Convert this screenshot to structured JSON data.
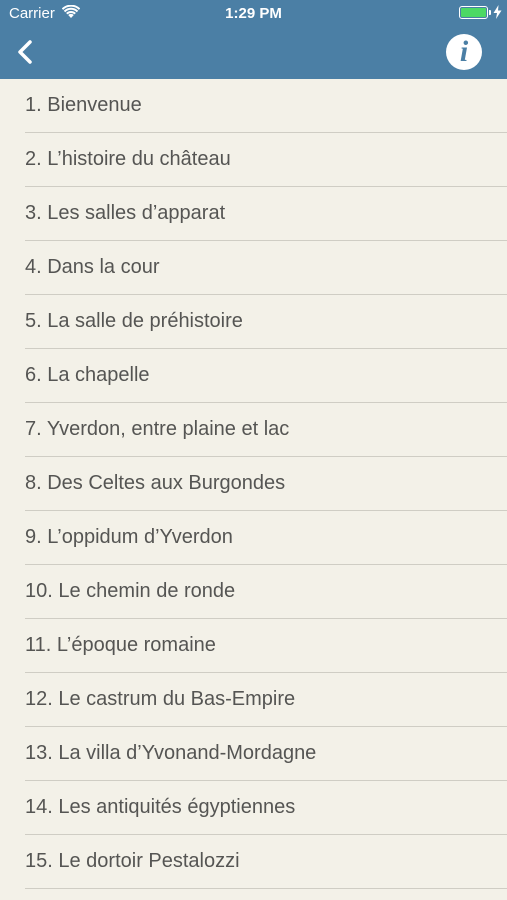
{
  "status_bar": {
    "carrier": "Carrier",
    "time": "1:29 PM",
    "battery_level": 1.0,
    "battery_color": "#4cd964"
  },
  "nav_bar": {
    "background_color": "#4b7fa5",
    "back_icon": "chevron-left-icon",
    "info_icon": "info-icon",
    "info_label": "i"
  },
  "list": {
    "items": [
      "1. Bienvenue",
      "2. L’histoire du château",
      "3. Les salles d’apparat",
      "4. Dans la cour",
      "5. La salle de préhistoire",
      "6. La chapelle",
      "7. Yverdon, entre plaine et lac",
      "8. Des Celtes aux Burgondes",
      "9. L’oppidum d’Yverdon",
      "10. Le chemin de ronde",
      "11. L’époque romaine",
      "12. Le castrum du Bas-Empire",
      "13. La villa d’Yvonand-Mordagne",
      "14. Les antiquités égyptiennes",
      "15. Le dortoir Pestalozzi"
    ]
  }
}
